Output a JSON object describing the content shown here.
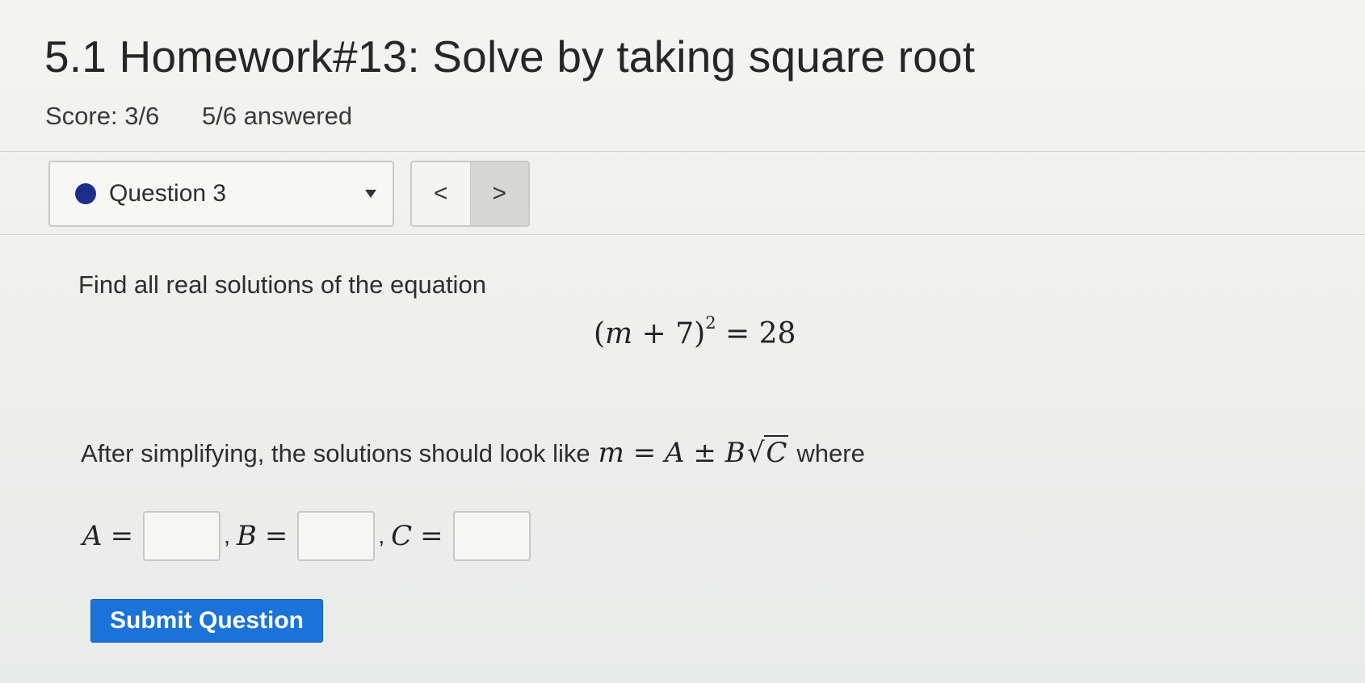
{
  "header": {
    "title": "5.1 Homework#13: Solve by taking square root",
    "score": "Score: 3/6",
    "answered": "5/6 answered"
  },
  "question_nav": {
    "selected": "Question 3",
    "prev_label": "<",
    "next_label": ">",
    "status_color": "#1f2d8a",
    "dropdown_icon": "caret-down-icon"
  },
  "question": {
    "prompt": "Find all real solutions of the equation",
    "equation": {
      "open": "(",
      "var": "m",
      "plus": " + 7)",
      "exp": "2",
      "rhs": " = 28"
    },
    "instruction_before": "After simplifying, the solutions should look like",
    "form": {
      "lhs": "m",
      "eq": " = ",
      "a": "A",
      "pm": " ± ",
      "b": "B",
      "radical": "√",
      "c": "C"
    },
    "instruction_after": "where"
  },
  "answers": [
    {
      "var": "A",
      "eq": "=",
      "value": ""
    },
    {
      "var": "B",
      "eq": "=",
      "value": ""
    },
    {
      "var": "C",
      "eq": "=",
      "value": ""
    }
  ],
  "separator": ",",
  "submit_label": "Submit Question",
  "colors": {
    "accent": "#1b72d8"
  }
}
